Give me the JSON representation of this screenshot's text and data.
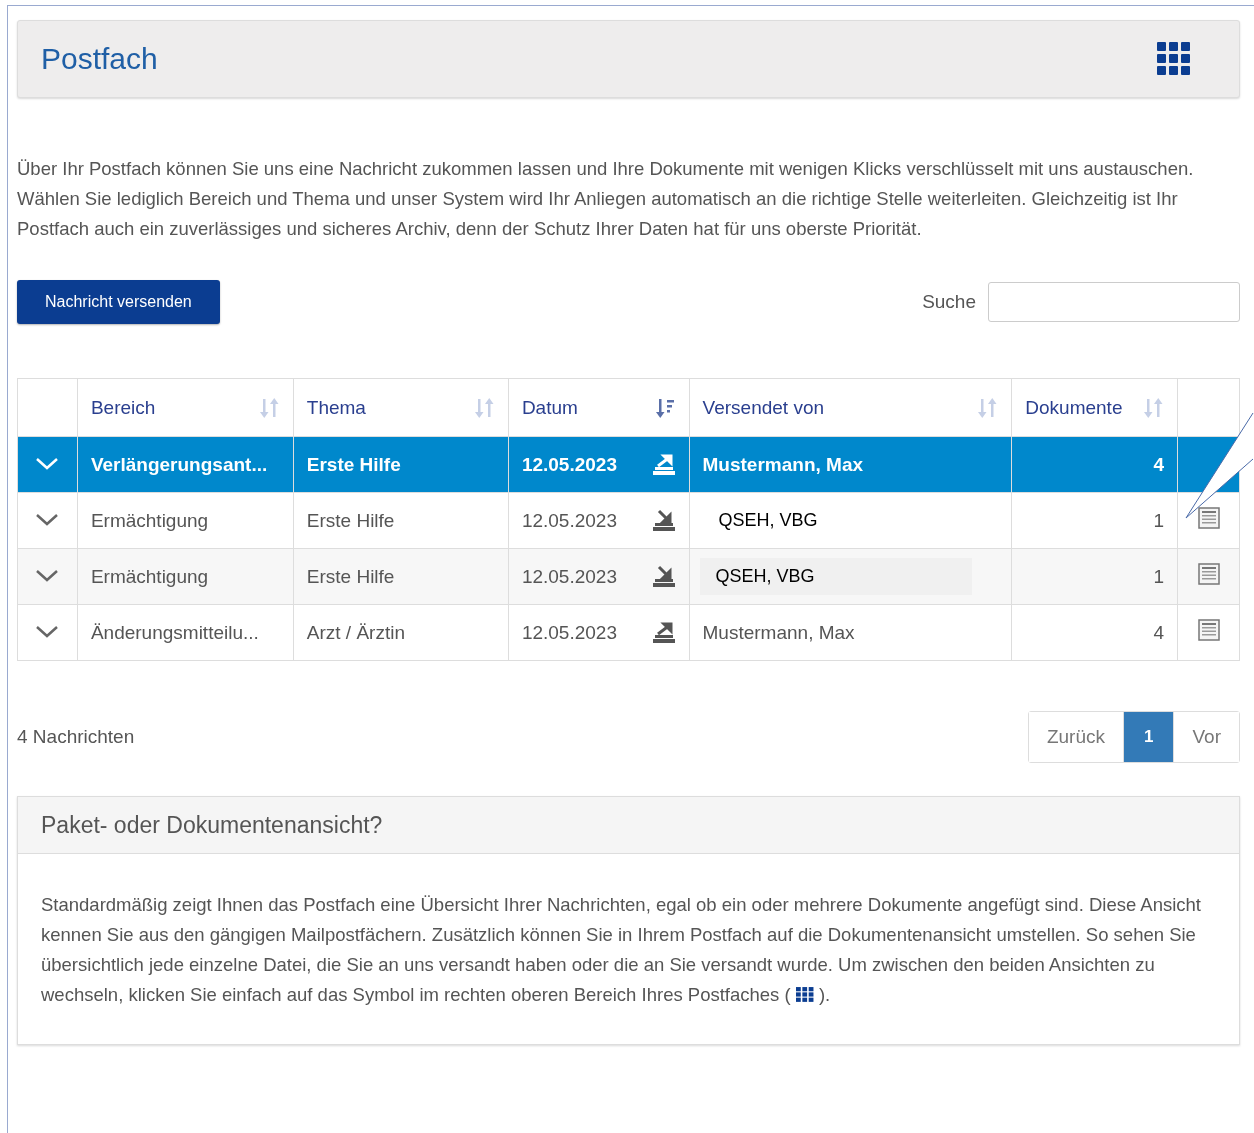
{
  "header": {
    "title": "Postfach"
  },
  "intro": "Über Ihr Postfach können Sie uns eine Nachricht zukommen lassen und Ihre Dokumente mit wenigen Klicks verschlüsselt mit uns austauschen. Wählen Sie lediglich Bereich und Thema und unser System wird Ihr Anliegen automatisch an die richtige Stelle weiterleiten. Gleichzeitig ist Ihr Postfach auch ein zuverlässiges und sicheres Archiv, denn der Schutz Ihrer Daten hat für uns oberste Priorität.",
  "send_button": "Nachricht versenden",
  "search": {
    "label": "Suche"
  },
  "table": {
    "columns": [
      {
        "label": "Bereich",
        "sorted": false
      },
      {
        "label": "Thema",
        "sorted": false
      },
      {
        "label": "Datum",
        "sorted": true
      },
      {
        "label": "Versendet von",
        "sorted": false
      },
      {
        "label": "Dokumente",
        "sorted": false
      }
    ],
    "rows": [
      {
        "selected": true,
        "bereich": "Verlängerungsant...",
        "thema": "Erste Hilfe",
        "datum": "12.05.2023",
        "date_icon": {
          "kind": "upload"
        },
        "sender": {
          "kind": "plain",
          "text": "Mustermann, Max"
        },
        "dokumente": "4"
      },
      {
        "selected": false,
        "bereich": "Ermächtigung",
        "thema": "Erste Hilfe",
        "datum": "12.05.2023",
        "date_icon": {
          "kind": "download"
        },
        "sender": {
          "kind": "tag",
          "text": "QSEH, VBG"
        },
        "dokumente": "1"
      },
      {
        "selected": false,
        "bereich": "Ermächtigung",
        "thema": "Erste Hilfe",
        "datum": "12.05.2023",
        "date_icon": {
          "kind": "download"
        },
        "sender": {
          "kind": "highlighted",
          "text": "QSEH, VBG"
        },
        "dokumente": "1"
      },
      {
        "selected": false,
        "bereich": "Änderungsmitteilu...",
        "thema": "Arzt / Ärztin",
        "datum": "12.05.2023",
        "date_icon": {
          "kind": "upload"
        },
        "sender": {
          "kind": "plain",
          "text": "Mustermann, Max"
        },
        "dokumente": "4"
      }
    ]
  },
  "count": "4 Nachrichten",
  "pagination": [
    {
      "label": "Zurück",
      "selected": false
    },
    {
      "label": "1",
      "selected": true
    },
    {
      "label": "Vor",
      "selected": false
    }
  ],
  "info": {
    "title": "Paket- oder Dokumentenansicht?",
    "text_before": "Standardmäßig zeigt Ihnen das Postfach eine Übersicht Ihrer Nachrichten, egal ob ein oder mehrere Dokumente angefügt sind. Diese Ansicht kennen Sie aus den gängigen Mailpostfächern. Zusätzlich können Sie in Ihrem Postfach auf die Dokumentenansicht umstellen. So sehen Sie übersichtlich jede einzelne Datei, die Sie an uns versandt haben oder die an Sie versandt wurde. Um zwischen den beiden Ansichten zu wechseln, klicken Sie einfach auf das Symbol im rechten oberen Bereich Ihres Postfaches (",
    "text_after": ")."
  }
}
